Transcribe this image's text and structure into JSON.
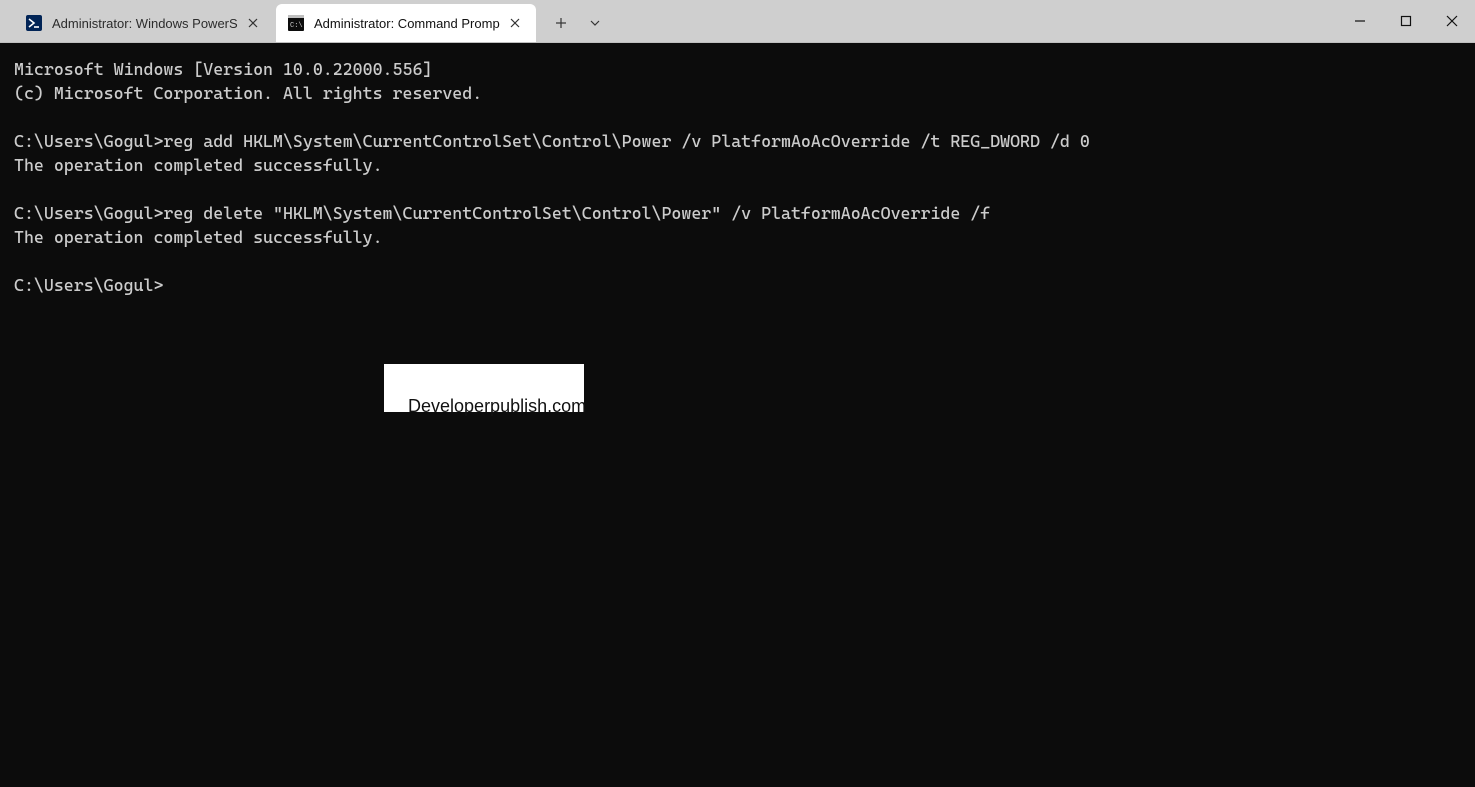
{
  "tabs": [
    {
      "title": "Administrator: Windows PowerS",
      "active": false,
      "icon": "powershell"
    },
    {
      "title": "Administrator: Command Promp",
      "active": true,
      "icon": "cmd"
    }
  ],
  "terminal": {
    "lines": [
      "Microsoft Windows [Version 10.0.22000.556]",
      "(c) Microsoft Corporation. All rights reserved.",
      "",
      "C:\\Users\\Gogul>reg add HKLM\\System\\CurrentControlSet\\Control\\Power /v PlatformAoAcOverride /t REG_DWORD /d 0",
      "The operation completed successfully.",
      "",
      "C:\\Users\\Gogul>reg delete \"HKLM\\System\\CurrentControlSet\\Control\\Power\" /v PlatformAoAcOverride /f",
      "The operation completed successfully.",
      "",
      "C:\\Users\\Gogul>"
    ]
  },
  "watermark": "Developerpublish.com"
}
